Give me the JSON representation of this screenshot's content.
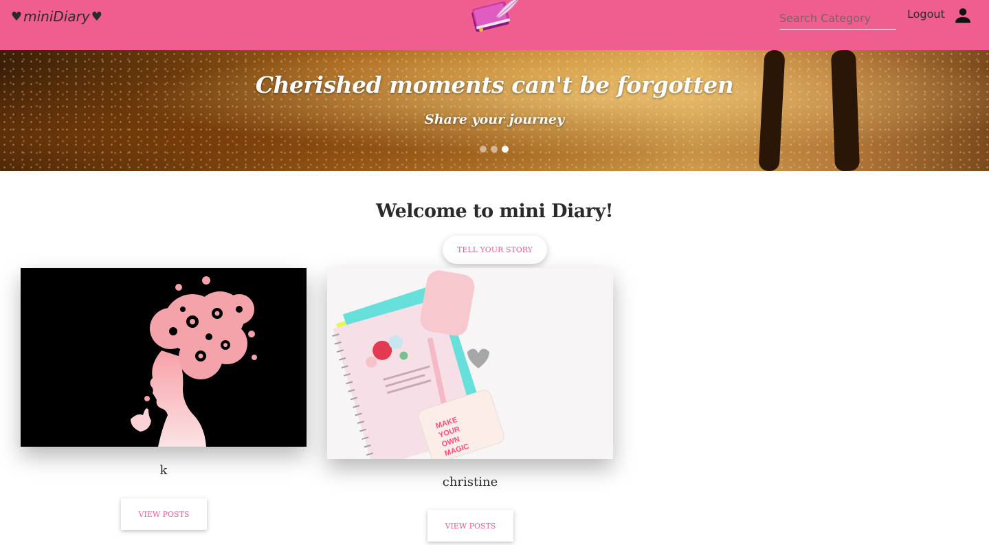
{
  "topbar": {
    "brand_heart_left": "♥",
    "brand": "miniDiary",
    "brand_heart_right": "♥",
    "logo_icon": "diary-quill-logo",
    "search_placeholder": "Search Category",
    "logout_label": "Logout",
    "user_icon": "person-icon",
    "bg_color": "#ef5e8e"
  },
  "hero": {
    "title": "Cherished moments can't be forgotten",
    "subtitle": "Share your journey",
    "slides": 3,
    "active_slide": 3
  },
  "main": {
    "welcome": "Welcome to mini Diary!",
    "cta_label": "Tell your story"
  },
  "cards": [
    {
      "name": "k",
      "button_label": "View posts",
      "image": "pink-floral-woman-silhouette"
    },
    {
      "name": "christine",
      "button_label": "View posts",
      "image": "notebook-flatlay-make-your-own-magic"
    }
  ],
  "colors": {
    "accent": "#ef5e8e",
    "text": "#2a2a2a"
  }
}
